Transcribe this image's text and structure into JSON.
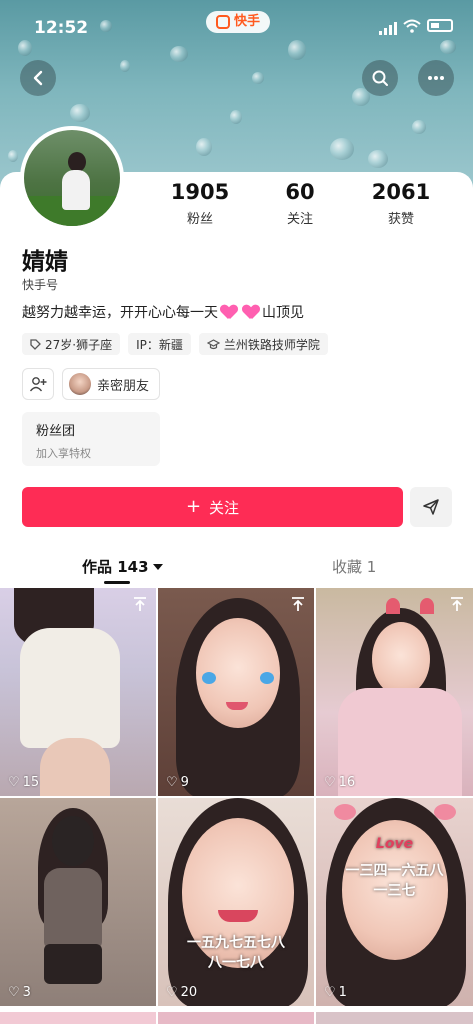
{
  "status_bar": {
    "time": "12:52",
    "app_badge": "快手"
  },
  "profile": {
    "name": "婧婧",
    "handle": "快手号",
    "bio_start": "越努力越幸运，开开心心每一天",
    "bio_end": "山顶见",
    "stats": [
      {
        "value": "1905",
        "label": "粉丝"
      },
      {
        "value": "60",
        "label": "关注"
      },
      {
        "value": "2061",
        "label": "获赞"
      }
    ],
    "tags": [
      "27岁·狮子座",
      "IP：新疆",
      "兰州铁路技师学院"
    ],
    "intimate_friends": "亲密朋友",
    "fan_club": {
      "title": "粉丝团",
      "subtitle": "加入享特权"
    },
    "follow_button": "关注"
  },
  "tabs": {
    "works_label": "作品 143",
    "favorites_label": "收藏 1"
  },
  "posts": [
    {
      "likes": "15",
      "pinned": true
    },
    {
      "likes": "9",
      "pinned": true
    },
    {
      "likes": "16",
      "pinned": true
    },
    {
      "likes": "3",
      "pinned": false
    },
    {
      "likes": "20",
      "pinned": false,
      "overlay": [
        "一五九七五七八",
        "八一七八"
      ]
    },
    {
      "likes": "1",
      "pinned": false,
      "overlay": [
        "Love",
        "一三四一六五八",
        "一三七"
      ]
    }
  ],
  "colors": {
    "accent": "#fe2c55",
    "brand": "#ff5a1f"
  }
}
